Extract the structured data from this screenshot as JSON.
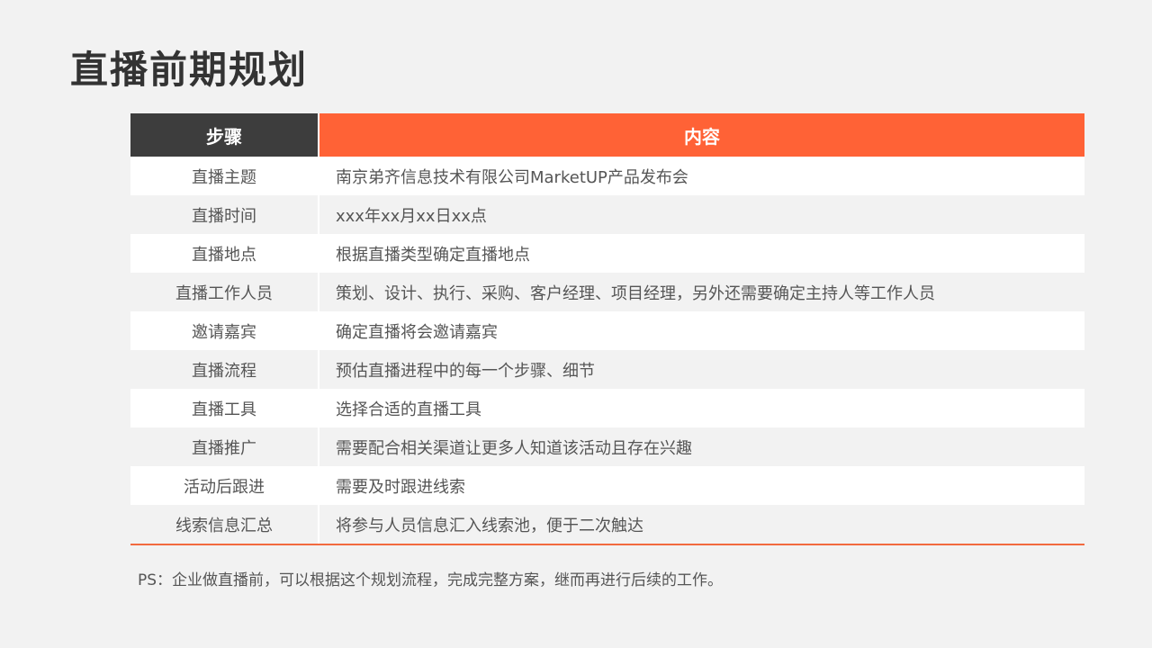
{
  "title": "直播前期规划",
  "table": {
    "headers": {
      "step": "步骤",
      "content": "内容"
    },
    "rows": [
      {
        "step": "直播主题",
        "content": "南京弟齐信息技术有限公司MarketUP产品发布会"
      },
      {
        "step": "直播时间",
        "content": "xxx年xx月xx日xx点"
      },
      {
        "step": "直播地点",
        "content": "根据直播类型确定直播地点"
      },
      {
        "step": "直播工作人员",
        "content": "策划、设计、执行、采购、客户经理、项目经理，另外还需要确定主持人等工作人员"
      },
      {
        "step": "邀请嘉宾",
        "content": "确定直播将会邀请嘉宾"
      },
      {
        "step": "直播流程",
        "content": "预估直播进程中的每一个步骤、细节"
      },
      {
        "step": "直播工具",
        "content": "选择合适的直播工具"
      },
      {
        "step": "直播推广",
        "content": "需要配合相关渠道让更多人知道该活动且存在兴趣"
      },
      {
        "step": "活动后跟进",
        "content": "需要及时跟进线索"
      },
      {
        "step": "线索信息汇总",
        "content": "将参与人员信息汇入线索池，便于二次触达"
      }
    ]
  },
  "note": "PS：企业做直播前，可以根据这个规划流程，完成完整方案，继而再进行后续的工作。",
  "colors": {
    "header_dark": "#3d3d3d",
    "header_accent": "#ff6236",
    "bottom_rule": "#f26a3f"
  }
}
